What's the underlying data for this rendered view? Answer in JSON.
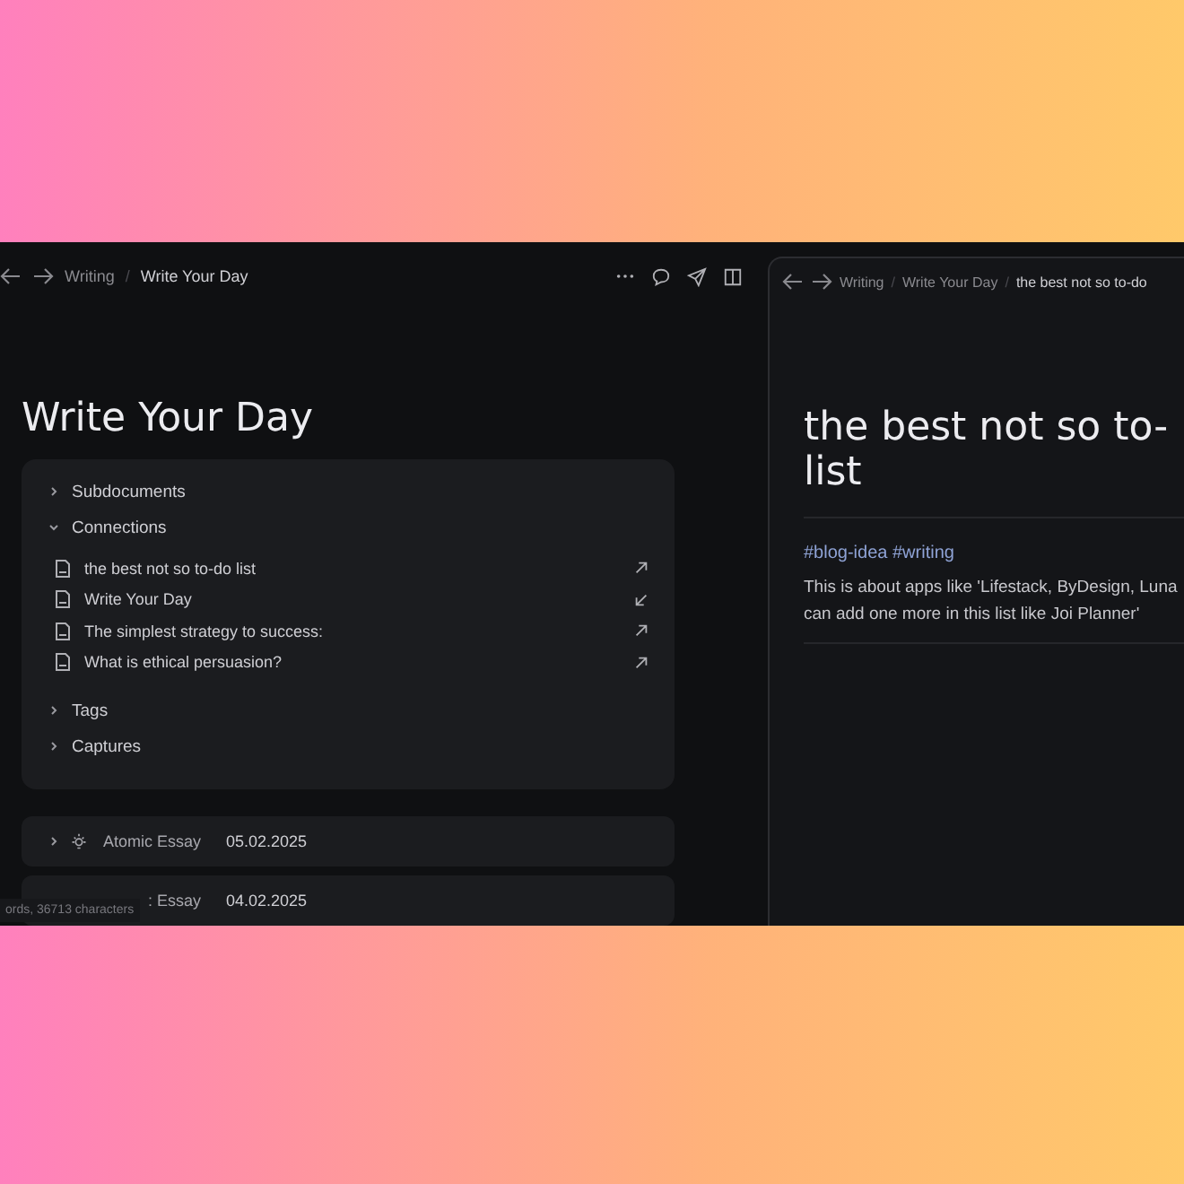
{
  "left_pane": {
    "breadcrumb": [
      "Writing",
      "/",
      "Write Your Day"
    ],
    "title": "Write Your Day",
    "sections": [
      {
        "label": "Subdocuments",
        "expanded": false
      },
      {
        "label": "Connections",
        "expanded": true,
        "items": [
          {
            "label": "the best not so to-do list",
            "kind": "outgoing"
          },
          {
            "label": "Write Your Day",
            "kind": "incoming"
          },
          {
            "label": "The simplest strategy to success:",
            "kind": "outgoing"
          },
          {
            "label": "What is ethical persuasion?",
            "kind": "outgoing"
          }
        ]
      },
      {
        "label": "Tags",
        "expanded": false
      },
      {
        "label": "Captures",
        "expanded": false
      }
    ],
    "rows": [
      {
        "label": "Atomic Essay",
        "date": "05.02.2025"
      },
      {
        "label": ": Essay",
        "date": "04.02.2025"
      }
    ],
    "status": "ords, 36713 characters"
  },
  "right_pane": {
    "breadcrumb": [
      "Writing",
      "/",
      "Write Your Day",
      "/",
      "the best not so to-do"
    ],
    "title": [
      "the best not so to-",
      "list"
    ],
    "tags": "#blog-idea #writing",
    "paragraph": [
      "This is about apps like 'Lifestack, ByDesign, Luna",
      "can add one more in this list like Joi Planner'"
    ]
  }
}
